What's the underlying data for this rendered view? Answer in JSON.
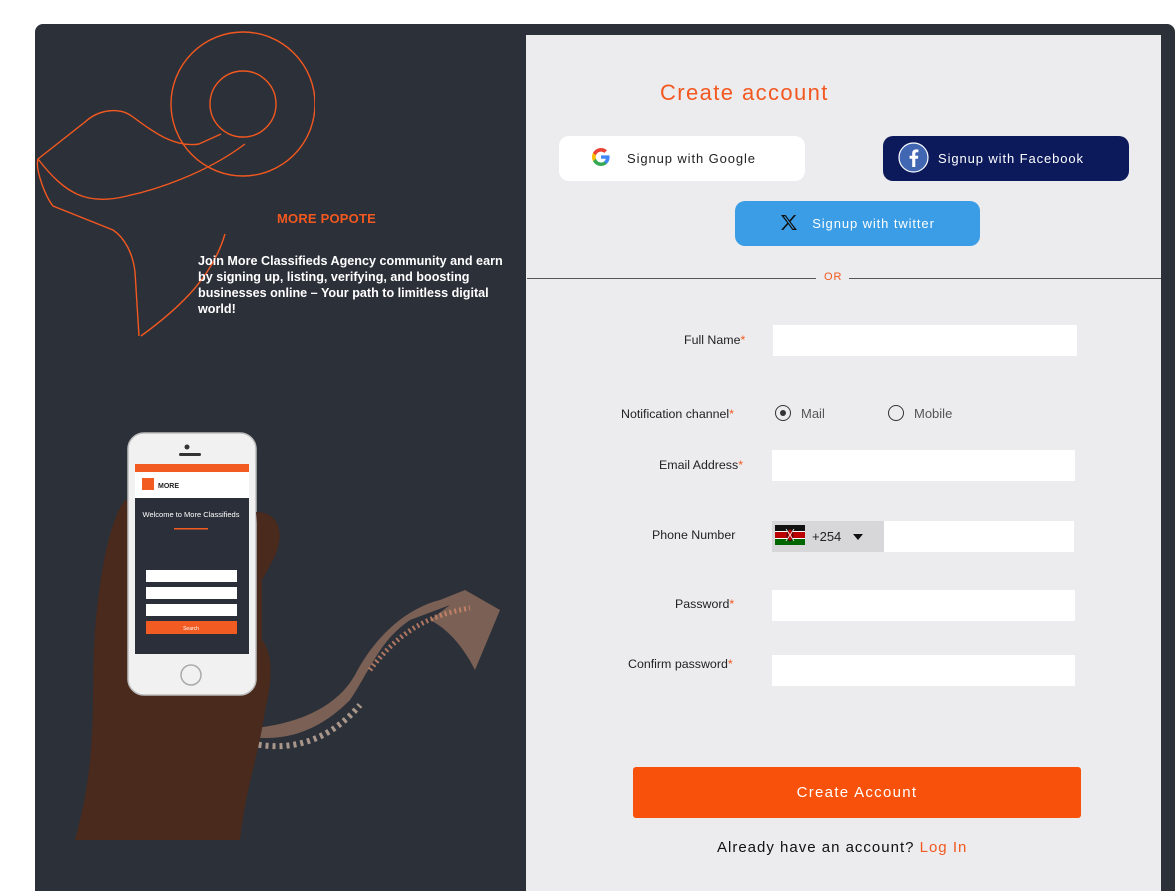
{
  "brand": {
    "name": "MORE POPOTE",
    "tagline": "Join More Classifieds Agency community and earn by signing up, listing, verifying, and boosting businesses online – Your path to limitless digital world!"
  },
  "illustration": {
    "phone_brand": "MORE",
    "phone_welcome": "Welcome to More Classifieds",
    "phone_search_button": "Search"
  },
  "form": {
    "title": "Create account",
    "google_label": "Signup with Google",
    "facebook_label": "Signup with Facebook",
    "twitter_label": "Signup with twitter",
    "divider_text": "OR",
    "full_name_label": "Full Name",
    "notification_label": "Notification channel",
    "channel_mail": "Mail",
    "channel_mobile": "Mobile",
    "channel_selected": "Mail",
    "email_label": "Email Address",
    "phone_label": "Phone Number",
    "phone_prefix": "+254",
    "password_label": "Password",
    "confirm_password_label": "Confirm password",
    "required_mark": "*",
    "submit_label": "Create Account",
    "login_prompt": "Already have an account?",
    "login_link": "Log In"
  },
  "colors": {
    "accent": "#f2581f",
    "button": "#f7510c",
    "panel_bg": "#ececee",
    "dark_bg": "#2c3039",
    "facebook": "#0c1a5c",
    "twitter": "#3a9de6"
  },
  "icons": {
    "google": "google-icon",
    "facebook": "facebook-icon",
    "twitter": "x-icon",
    "flag": "kenya-flag-icon",
    "dropdown": "caret-down-icon"
  }
}
